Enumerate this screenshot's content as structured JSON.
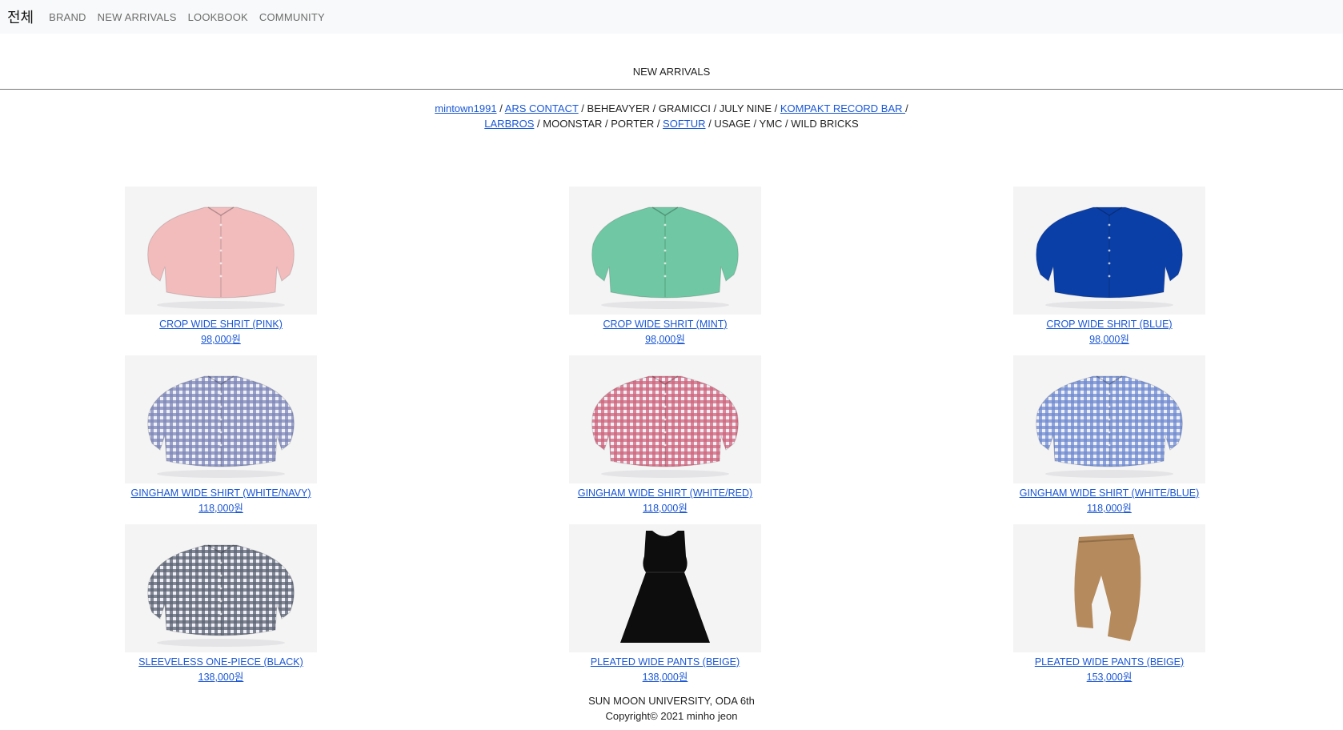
{
  "nav": {
    "home": "전체",
    "links": [
      "BRAND",
      "NEW ARRIVALS",
      "LOOKBOOK",
      "COMMUNITY"
    ]
  },
  "section_title": "NEW ARRIVALS",
  "brands": {
    "line1": [
      {
        "text": "mintown1991",
        "link": true
      },
      {
        "text": "ARS CONTACT",
        "link": true
      },
      {
        "text": "BEHEAVYER",
        "link": false
      },
      {
        "text": "GRAMICCI",
        "link": false
      },
      {
        "text": "JULY NINE",
        "link": false
      },
      {
        "text": "KOMPAKT RECORD BAR ",
        "link": true
      }
    ],
    "line2": [
      {
        "text": "LARBROS",
        "link": true
      },
      {
        "text": "MOONSTAR",
        "link": false
      },
      {
        "text": "PORTER",
        "link": false
      },
      {
        "text": "SOFTUR",
        "link": true
      },
      {
        "text": "USAGE",
        "link": false
      },
      {
        "text": "YMC",
        "link": false
      },
      {
        "text": "WILD BRICKS",
        "link": false
      }
    ],
    "separator": " / "
  },
  "products": [
    {
      "name": "CROP WIDE SHRIT (PINK)",
      "price": "98,000원",
      "icon": "shirt-icon",
      "color": "#f2bcbd",
      "pattern": "solid"
    },
    {
      "name": "CROP WIDE SHRIT (MINT)",
      "price": "98,000원",
      "icon": "shirt-icon",
      "color": "#6fc8a3",
      "pattern": "solid"
    },
    {
      "name": "CROP WIDE SHRIT (BLUE)",
      "price": "98,000원",
      "icon": "shirt-icon",
      "color": "#0b3fa8",
      "pattern": "solid"
    },
    {
      "name": "GINGHAM WIDE SHIRT (WHITE/NAVY)",
      "price": "118,000원",
      "icon": "gingham-shirt-icon",
      "color": "#7d86b8",
      "pattern": "gingham"
    },
    {
      "name": "GINGHAM WIDE SHIRT (WHITE/RED)",
      "price": "118,000원",
      "icon": "gingham-shirt-icon",
      "color": "#d0647a",
      "pattern": "gingham"
    },
    {
      "name": "GINGHAM WIDE SHIRT (WHITE/BLUE)",
      "price": "118,000원",
      "icon": "gingham-shirt-icon",
      "color": "#6f8ad0",
      "pattern": "gingham"
    },
    {
      "name": "SLEEVELESS ONE-PIECE (BLACK)",
      "price": "138,000원",
      "icon": "gingham-shirt-icon",
      "color": "#5c6273",
      "pattern": "gingham"
    },
    {
      "name": "PLEATED WIDE PANTS (BEIGE)",
      "price": "138,000원",
      "icon": "dress-icon",
      "color": "#0d0d0d",
      "pattern": "dress"
    },
    {
      "name": "PLEATED WIDE PANTS (BEIGE)",
      "price": "153,000원",
      "icon": "pants-icon",
      "color": "#b58a5c",
      "pattern": "pants"
    }
  ],
  "footer": {
    "line1": "SUN MOON UNIVERSITY, ODA 6th",
    "line2": "Copyright© 2021 minho jeon"
  }
}
